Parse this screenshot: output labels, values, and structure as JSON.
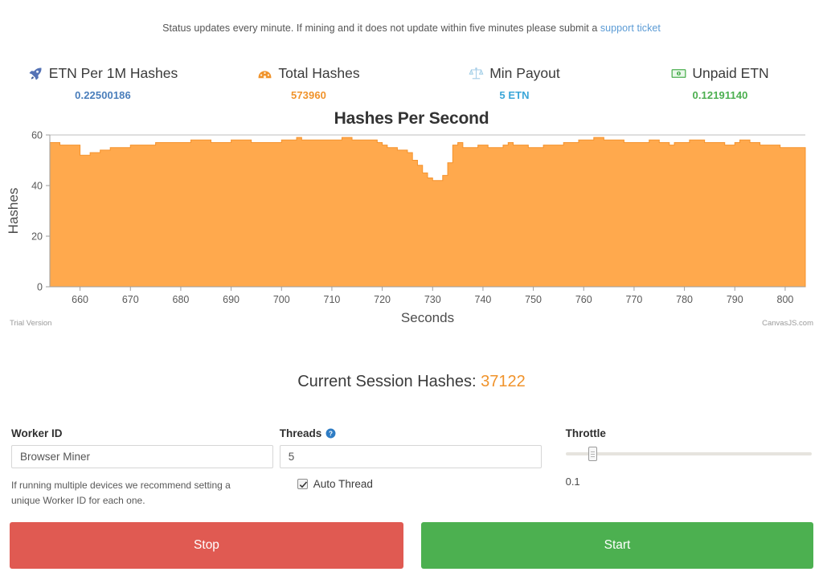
{
  "status": {
    "text_before": "Status updates every minute. If mining and it does not update within five minutes please submit a ",
    "link_label": "support ticket",
    "link_color": "#5b9bd5"
  },
  "stats": [
    {
      "icon": "rocket-icon",
      "label": "ETN Per 1M Hashes",
      "value": "0.22500186",
      "value_color": "#4a7ebb"
    },
    {
      "icon": "speedometer-icon",
      "label": "Total Hashes",
      "value": "573960",
      "value_color": "#f0932b"
    },
    {
      "icon": "balance-scale-icon",
      "label": "Min Payout",
      "value": "5 ETN",
      "value_color": "#3aa6d8"
    },
    {
      "icon": "banknote-icon",
      "label": "Unpaid ETN",
      "value": "0.12191140",
      "value_color": "#4caf50"
    }
  ],
  "chart_data": {
    "type": "area",
    "title": "Hashes Per Second",
    "xlabel": "Seconds",
    "ylabel": "Hashes",
    "xlim": [
      654,
      804
    ],
    "ylim": [
      0,
      60
    ],
    "xticks": [
      660,
      670,
      680,
      690,
      700,
      710,
      720,
      730,
      740,
      750,
      760,
      770,
      780,
      790,
      800
    ],
    "yticks": [
      0,
      20,
      40,
      60
    ],
    "grid": true,
    "legend": false,
    "fill_color": "#FFA94D",
    "line_color": "#F5922B",
    "watermark_left": "Trial Version",
    "watermark_right": "CanvasJS.com",
    "x": [
      654,
      655,
      656,
      657,
      658,
      659,
      660,
      661,
      662,
      663,
      664,
      665,
      666,
      667,
      668,
      669,
      670,
      671,
      672,
      673,
      674,
      675,
      676,
      677,
      678,
      679,
      680,
      681,
      682,
      683,
      684,
      685,
      686,
      687,
      688,
      689,
      690,
      691,
      692,
      693,
      694,
      695,
      696,
      697,
      698,
      699,
      700,
      701,
      702,
      703,
      704,
      705,
      706,
      707,
      708,
      709,
      710,
      711,
      712,
      713,
      714,
      715,
      716,
      717,
      718,
      719,
      720,
      721,
      722,
      723,
      724,
      725,
      726,
      727,
      728,
      729,
      730,
      731,
      732,
      733,
      734,
      735,
      736,
      737,
      738,
      739,
      740,
      741,
      742,
      743,
      744,
      745,
      746,
      747,
      748,
      749,
      750,
      751,
      752,
      753,
      754,
      755,
      756,
      757,
      758,
      759,
      760,
      761,
      762,
      763,
      764,
      765,
      766,
      767,
      768,
      769,
      770,
      771,
      772,
      773,
      774,
      775,
      776,
      777,
      778,
      779,
      780,
      781,
      782,
      783,
      784,
      785,
      786,
      787,
      788,
      789,
      790,
      791,
      792,
      793,
      794,
      795,
      796,
      797,
      798,
      799,
      800,
      801,
      802,
      803
    ],
    "values": [
      57,
      57,
      56,
      56,
      56,
      56,
      52,
      52,
      53,
      53,
      54,
      54,
      55,
      55,
      55,
      55,
      56,
      56,
      56,
      56,
      56,
      57,
      57,
      57,
      57,
      57,
      57,
      57,
      58,
      58,
      58,
      58,
      57,
      57,
      57,
      57,
      58,
      58,
      58,
      58,
      57,
      57,
      57,
      57,
      57,
      57,
      58,
      58,
      58,
      59,
      58,
      58,
      58,
      58,
      58,
      58,
      58,
      58,
      59,
      59,
      58,
      58,
      58,
      58,
      58,
      57,
      56,
      55,
      55,
      54,
      54,
      53,
      50,
      48,
      45,
      43,
      42,
      42,
      44,
      49,
      56,
      57,
      55,
      55,
      55,
      56,
      56,
      55,
      55,
      55,
      56,
      57,
      56,
      56,
      56,
      55,
      55,
      55,
      56,
      56,
      56,
      56,
      57,
      57,
      57,
      58,
      58,
      58,
      59,
      59,
      58,
      58,
      58,
      58,
      57,
      57,
      57,
      57,
      57,
      58,
      58,
      57,
      57,
      56,
      57,
      57,
      57,
      58,
      58,
      58,
      57,
      57,
      57,
      57,
      56,
      56,
      57,
      58,
      58,
      57,
      57,
      56,
      56,
      56,
      56,
      55,
      55,
      55,
      55,
      55
    ]
  },
  "session": {
    "label": "Current Session Hashes:",
    "value": "37122",
    "value_color": "#f0932b"
  },
  "form": {
    "worker": {
      "label": "Worker ID",
      "value": "Browser Miner",
      "placeholder": "Worker ID",
      "hint": "If running multiple devices we recommend setting a unique Worker ID for each one."
    },
    "threads": {
      "label": "Threads",
      "help_icon": "question-circle-icon",
      "value": "5",
      "placeholder": "Threads",
      "auto_thread_label": "Auto Thread",
      "auto_thread_checked": true
    },
    "throttle": {
      "label": "Throttle",
      "value": "0.1",
      "min": "0",
      "max": "1"
    }
  },
  "buttons": {
    "stop_label": "Stop",
    "stop_color": "#e05a52",
    "start_label": "Start",
    "start_color": "#4cb050"
  }
}
